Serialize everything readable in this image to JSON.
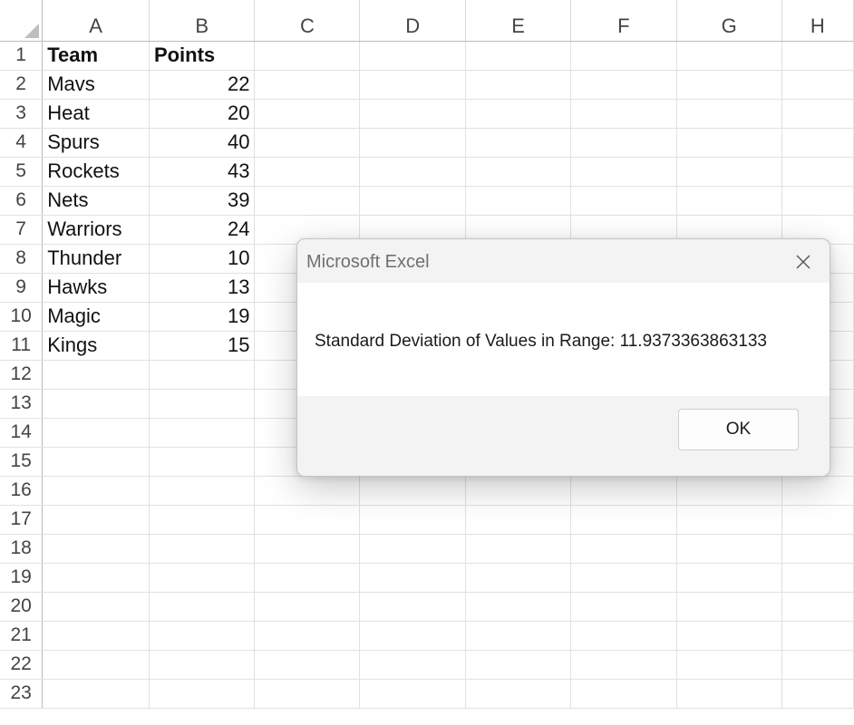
{
  "sheet": {
    "columns": [
      "A",
      "B",
      "C",
      "D",
      "E",
      "F",
      "G",
      "H"
    ],
    "rows": [
      {
        "num": "1",
        "a": "Team",
        "b": "Points"
      },
      {
        "num": "2",
        "a": "Mavs",
        "b": "22"
      },
      {
        "num": "3",
        "a": "Heat",
        "b": "20"
      },
      {
        "num": "4",
        "a": "Spurs",
        "b": "40"
      },
      {
        "num": "5",
        "a": "Rockets",
        "b": "43"
      },
      {
        "num": "6",
        "a": "Nets",
        "b": "39"
      },
      {
        "num": "7",
        "a": "Warriors",
        "b": "24"
      },
      {
        "num": "8",
        "a": "Thunder",
        "b": "10"
      },
      {
        "num": "9",
        "a": "Hawks",
        "b": "13"
      },
      {
        "num": "10",
        "a": "Magic",
        "b": "19"
      },
      {
        "num": "11",
        "a": "Kings",
        "b": "15"
      },
      {
        "num": "12",
        "a": "",
        "b": ""
      },
      {
        "num": "13",
        "a": "",
        "b": ""
      },
      {
        "num": "14",
        "a": "",
        "b": ""
      },
      {
        "num": "15",
        "a": "",
        "b": ""
      },
      {
        "num": "16",
        "a": "",
        "b": ""
      },
      {
        "num": "17",
        "a": "",
        "b": ""
      },
      {
        "num": "18",
        "a": "",
        "b": ""
      },
      {
        "num": "19",
        "a": "",
        "b": ""
      },
      {
        "num": "20",
        "a": "",
        "b": ""
      },
      {
        "num": "21",
        "a": "",
        "b": ""
      },
      {
        "num": "22",
        "a": "",
        "b": ""
      },
      {
        "num": "23",
        "a": "",
        "b": ""
      }
    ]
  },
  "dialog": {
    "title": "Microsoft Excel",
    "message": "Standard Deviation of Values in Range: 11.9373363863133",
    "ok_label": "OK",
    "close_icon": "close-icon"
  },
  "colors": {
    "grid_line": "#e1e1e1",
    "dialog_bg": "#f3f3f3",
    "dialog_body": "#ffffff"
  }
}
